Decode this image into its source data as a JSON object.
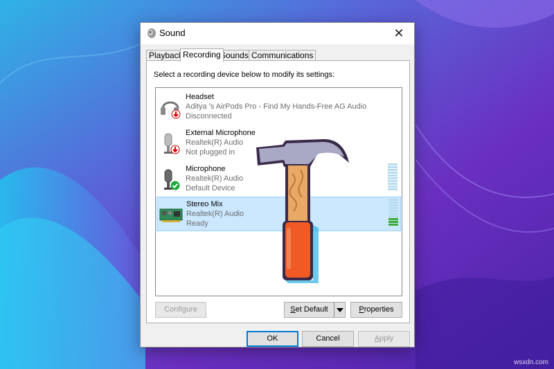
{
  "dialog": {
    "title": "Sound",
    "close_glyph": "✕"
  },
  "tabs": [
    {
      "label": "Playback",
      "active": false
    },
    {
      "label": "Recording",
      "active": true
    },
    {
      "label": "Sounds",
      "active": false
    },
    {
      "label": "Communications",
      "active": false
    }
  ],
  "hint": "Select a recording device below to modify its settings:",
  "devices": [
    {
      "name": "Headset",
      "driver": "Aditya 's AirPods Pro - Find My Hands-Free AG Audio",
      "status": "Disconnected",
      "icon": "headset-icon",
      "badge": "red-down-arrow"
    },
    {
      "name": "External Microphone",
      "driver": "Realtek(R) Audio",
      "status": "Not plugged in",
      "icon": "microphone-icon",
      "badge": "red-down-arrow"
    },
    {
      "name": "Microphone",
      "driver": "Realtek(R) Audio",
      "status": "Default Device",
      "icon": "microphone-icon",
      "badge": "green-check"
    },
    {
      "name": "Stereo Mix",
      "driver": "Realtek(R) Audio",
      "status": "Ready",
      "icon": "sound-card-icon",
      "badge": "none",
      "selected": true
    }
  ],
  "meters": {
    "microphone_level": 0,
    "stereo_mix_level": 0.3
  },
  "buttons": {
    "configure": "Configure",
    "set_default": "Set Default",
    "properties": "Properties",
    "ok": "OK",
    "cancel": "Cancel",
    "apply": "Apply"
  },
  "watermark": "wsxdn.com",
  "colors": {
    "selection": "#cce8ff",
    "accent": "#0078d7",
    "meter_active": "#3caa3c",
    "hammer_handle": "#f05a24",
    "hammer_head": "#a9a9c6"
  }
}
